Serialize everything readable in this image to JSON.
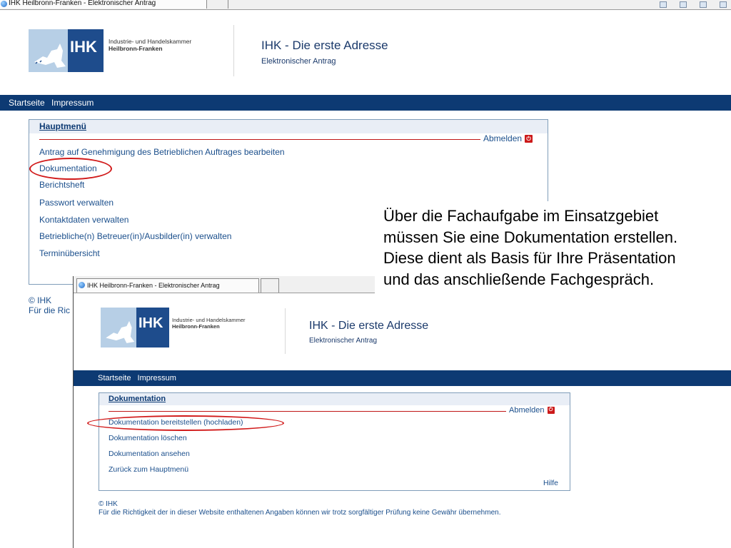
{
  "win1": {
    "tab_title": "IHK Heilbronn-Franken - Elektronischer Antrag",
    "logo": {
      "text": "IHK",
      "line1": "Industrie- und Handelskammer",
      "line2": "Heilbronn-Franken"
    },
    "header": {
      "title": "IHK - Die erste Adresse",
      "subtitle": "Elektronischer Antrag"
    },
    "nav": [
      "Startseite",
      "Impressum"
    ],
    "panel": {
      "heading": "Hauptmenü",
      "logout": "Abmelden",
      "items": [
        "Antrag auf Genehmigung des Betrieblichen Auftrages bearbeiten",
        "Dokumentation",
        "Berichtsheft",
        "Passwort verwalten",
        "Kontaktdaten verwalten",
        "Betriebliche(n) Betreuer(in)/Ausbilder(in) verwalten",
        "Terminübersicht"
      ]
    },
    "footer": {
      "copyright": "© IHK",
      "note": "Für die Ric"
    }
  },
  "overlay": {
    "lines": [
      "Über die Fachaufgabe im Einsatzgebiet",
      "müssen Sie eine Dokumentation erstellen.",
      "Diese dient als Basis für Ihre Präsentation",
      "und das anschließende Fachgespräch."
    ]
  },
  "win2": {
    "tab_title": "IHK Heilbronn-Franken - Elektronischer Antrag",
    "logo": {
      "text": "IHK",
      "line1": "Industrie- und Handelskammer",
      "line2": "Heilbronn-Franken"
    },
    "header": {
      "title": "IHK - Die erste Adresse",
      "subtitle": "Elektronischer Antrag"
    },
    "nav": [
      "Startseite",
      "Impressum"
    ],
    "panel": {
      "heading": "Dokumentation",
      "logout": "Abmelden",
      "items": [
        "Dokumentation bereitstellen (hochladen)",
        "Dokumentation löschen",
        "Dokumentation ansehen",
        "Zurück zum Hauptmenü"
      ],
      "help": "Hilfe"
    },
    "footer": {
      "copyright": "© IHK",
      "note": "Für die Richtigkeit der in dieser Website enthaltenen Angaben können wir trotz sorgfältiger Prüfung keine Gewähr übernehmen."
    }
  },
  "colors": {
    "brand_blue": "#1e4c8c",
    "navbar": "#0d3a73",
    "highlight_red": "#d11a1a",
    "link": "#1b4f8c"
  },
  "icons": [
    "ie-browser-icon",
    "power-logout-icon",
    "ihk-logo-icon"
  ]
}
